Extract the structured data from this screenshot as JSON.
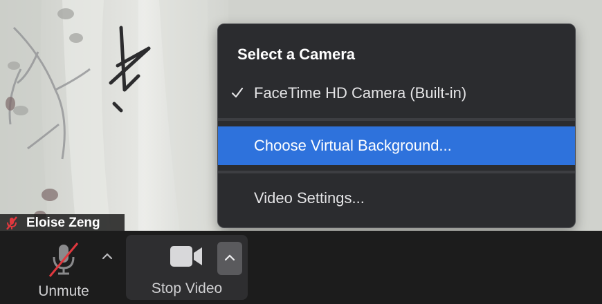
{
  "participant": {
    "name": "Eloise Zeng",
    "icon": "muted-mic-icon"
  },
  "camera_menu": {
    "header": "Select a Camera",
    "items": [
      {
        "label": "FaceTime HD Camera (Built-in)",
        "checked": true,
        "highlighted": false
      },
      {
        "label": "Choose Virtual Background...",
        "checked": false,
        "highlighted": true
      },
      {
        "label": "Video Settings...",
        "checked": false,
        "highlighted": false
      }
    ],
    "check_icon": "checkmark-icon",
    "highlight_color": "#2e72dc",
    "background_color": "#2b2c2f"
  },
  "toolbar": {
    "unmute_label": "Unmute",
    "unmute_icon": "muted-microphone-icon",
    "audio_caret_icon": "chevron-up-icon",
    "stop_video_label": "Stop Video",
    "video_icon": "video-camera-icon",
    "video_caret_icon": "chevron-up-icon",
    "muted_color": "#e0383e"
  }
}
